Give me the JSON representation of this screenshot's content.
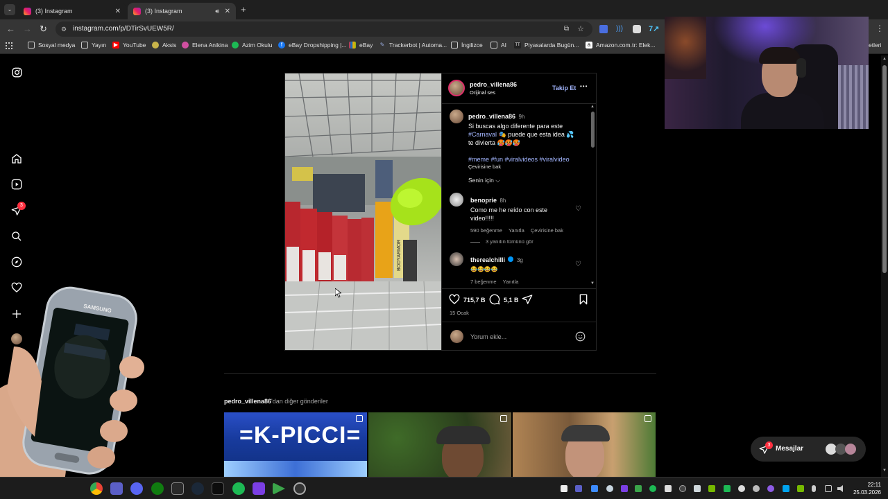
{
  "browser": {
    "tabs": [
      {
        "title": "(3) Instagram",
        "active": false
      },
      {
        "title": "(3) Instagram",
        "active": true
      }
    ],
    "new_tab": "+",
    "url": "instagram.com/p/DTirSvUEW5R/",
    "bookmarks": [
      "Sosyal medya",
      "Yayın",
      "YouTube",
      "Aksis",
      "Elena Anikina",
      "Azim Okulu",
      "eBay Dropshipping |...",
      "eBay",
      "Trackerbot | Automa...",
      "İngilizce",
      "AI",
      "Piyasalarda Bugün...",
      "Amazon.com.tr: Elek...",
      "etleri"
    ]
  },
  "sidebar": {
    "notification_badge": "3"
  },
  "post": {
    "author": "pedro_villena86",
    "audio": "Orijinal ses",
    "follow_label": "Takip Et",
    "more_label": "•••",
    "caption": {
      "user": "pedro_villena86",
      "time": "9h",
      "line1": "Si buscas algo diferente para este",
      "tag1": "#Carnaval",
      "line2_rest": "🎭 puede que esta idea 💦",
      "line3": "te divierta 🥵🥵🥵",
      "hashtags": "#meme #fun #viralvideos #viralvideo",
      "translate": "Çevirisine bak"
    },
    "for_you": "Senin için",
    "comments": [
      {
        "user": "benoprie",
        "time": "8h",
        "text1": "Como me he reído con este",
        "text2": "video!!!!!",
        "likes": "590 beğenme",
        "reply": "Yanıtla",
        "translate": "Çevirisine bak",
        "view_replies": "3 yanıtın tümünü gör"
      },
      {
        "user": "therealchilli",
        "time": "3g",
        "text1": "😂😂😂😂",
        "likes": "7 beğenme",
        "reply": "Yanıtla"
      }
    ],
    "likes_count": "715,7 B",
    "comments_count": "5,1 B",
    "date": "15 Ocak",
    "comment_placeholder": "Yorum ekle..."
  },
  "more_posts": {
    "user": "pedro_villena86",
    "suffix": "'dan diğer gönderiler",
    "thumb1_text": "=K-PICCI="
  },
  "messages": {
    "label": "Mesajlar",
    "badge": "3"
  },
  "video_bottle_labels": [
    "BODYARMOR"
  ],
  "clock": {
    "time": "22:11",
    "date": "25.03.2026"
  },
  "phone_brand": "SAMSUNG",
  "colors": {
    "accent_link": "#a3b6ff",
    "badge_red": "#ff3040",
    "follow_blue": "#a3b6ff"
  }
}
